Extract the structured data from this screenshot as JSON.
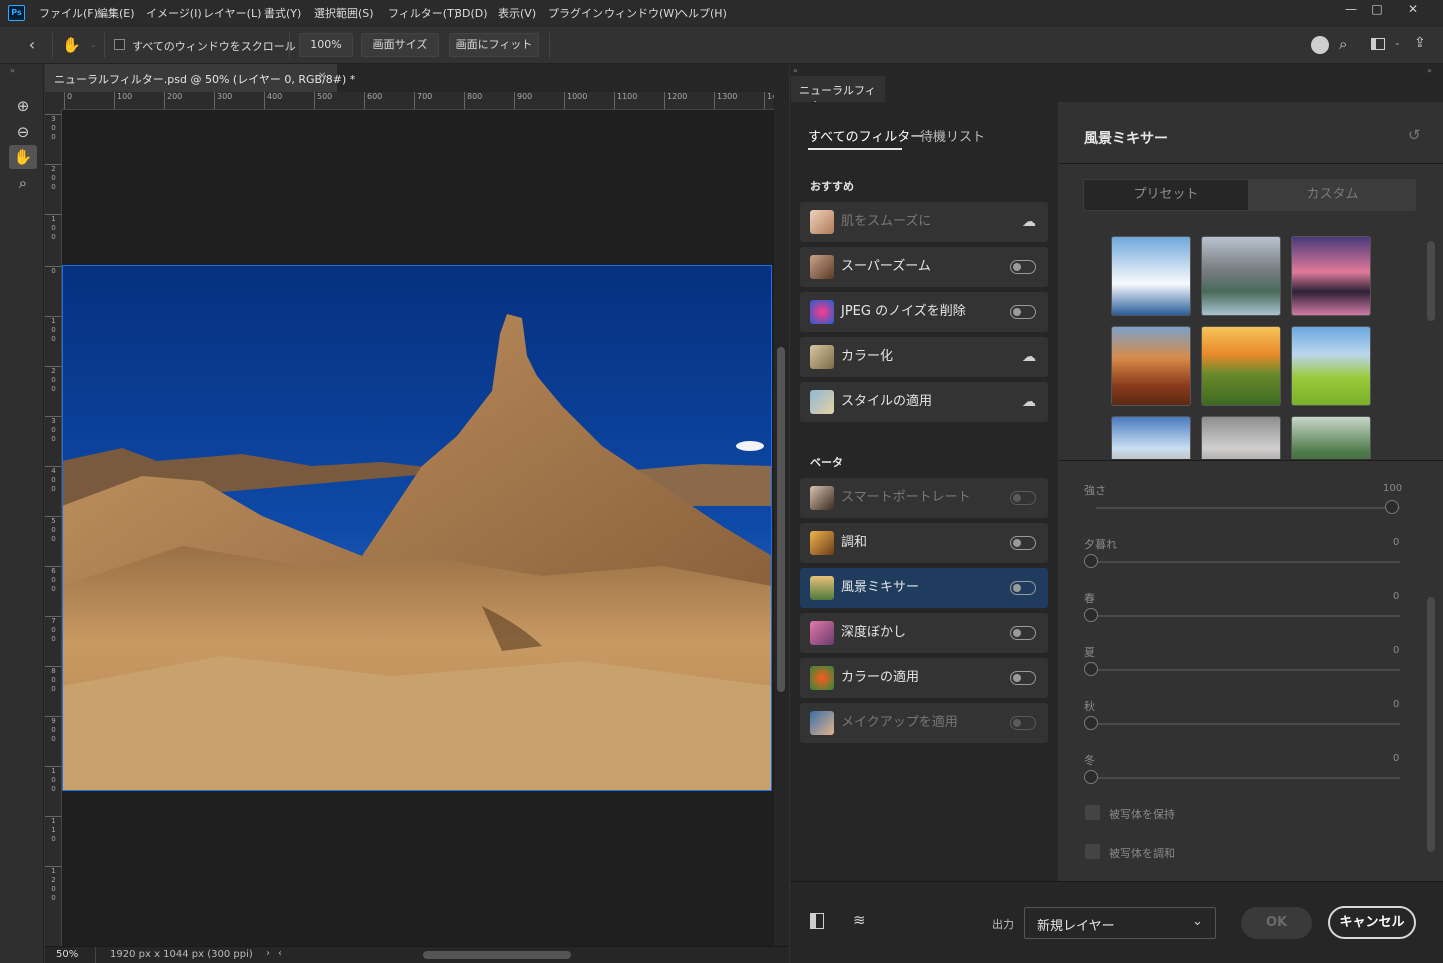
{
  "menu": [
    "ファイル(F)",
    "編集(E)",
    "イメージ(I)",
    "レイヤー(L)",
    "書式(Y)",
    "選択範囲(S)",
    "フィルター(T)",
    "3D(D)",
    "表示(V)",
    "プラグイン",
    "ウィンドウ(W)",
    "ヘルプ(H)"
  ],
  "app_logo": "Ps",
  "options": {
    "scroll_all_label": "すべてのウィンドウをスクロール",
    "zoom_value": "100%",
    "screen_size_label": "画面サイズ",
    "fit_screen_label": "画面にフィット"
  },
  "document": {
    "tab_title": "ニューラルフィルター.psd @ 50% (レイヤー 0, RGB/8#) *",
    "ruler_h": [
      "0",
      "100",
      "200",
      "300",
      "400",
      "500",
      "600",
      "700",
      "800",
      "900",
      "1000",
      "1100",
      "1200",
      "1300",
      "14"
    ],
    "ruler_v": [
      "3\n0\n0",
      "2\n0\n0",
      "1\n0\n0",
      "0",
      "1\n0\n0",
      "2\n0\n0",
      "3\n0\n0",
      "4\n0\n0",
      "5\n0\n0",
      "6\n0\n0",
      "7\n0\n0",
      "8\n0\n0",
      "9\n0\n0",
      "1\n0\n0",
      "1\n1\n0",
      "1\n2\n0\n0"
    ],
    "status_zoom": "50%",
    "status_info": "1920 px x 1044 px (300 ppi)"
  },
  "neural": {
    "panel_tab": "ニューラルフィルター",
    "tab_all": "すべてのフィルター",
    "tab_waitlist": "待機リスト",
    "section_featured": "おすすめ",
    "section_beta": "ベータ",
    "featured": [
      {
        "name": "肌をスムーズに",
        "state": "cloud",
        "dim": true
      },
      {
        "name": "スーパーズーム",
        "state": "toggle",
        "dim": false
      },
      {
        "name": "JPEG のノイズを削除",
        "state": "toggle",
        "dim": false
      },
      {
        "name": "カラー化",
        "state": "cloud",
        "dim": false
      },
      {
        "name": "スタイルの適用",
        "state": "cloud",
        "dim": false
      }
    ],
    "beta": [
      {
        "name": "スマートポートレート",
        "state": "toggle",
        "dim": true
      },
      {
        "name": "調和",
        "state": "toggle",
        "dim": false
      },
      {
        "name": "風景ミキサー",
        "state": "toggle",
        "dim": false,
        "active": true
      },
      {
        "name": "深度ぼかし",
        "state": "toggle",
        "dim": false
      },
      {
        "name": "カラーの適用",
        "state": "toggle",
        "dim": false
      },
      {
        "name": "メイクアップを適用",
        "state": "toggle",
        "dim": true
      }
    ],
    "settings_title": "風景ミキサー",
    "seg_preset": "プリセット",
    "seg_custom": "カスタム",
    "sliders": [
      {
        "label": "強さ",
        "value": "100",
        "pos": 1.0
      },
      {
        "label": "夕暮れ",
        "value": "0",
        "pos": 0
      },
      {
        "label": "春",
        "value": "0",
        "pos": 0
      },
      {
        "label": "夏",
        "value": "0",
        "pos": 0
      },
      {
        "label": "秋",
        "value": "0",
        "pos": 0
      },
      {
        "label": "冬",
        "value": "0",
        "pos": 0
      }
    ],
    "checkbox_keep": "被写体を保持",
    "checkbox_harmonize": "被写体を調和",
    "output_label": "出力",
    "output_value": "新規レイヤー",
    "ok_label": "OK",
    "cancel_label": "キャンセル"
  },
  "colors": {
    "accent": "#1473e6",
    "active_item": "#1f3c5e",
    "sky": "#0a3d8f"
  }
}
